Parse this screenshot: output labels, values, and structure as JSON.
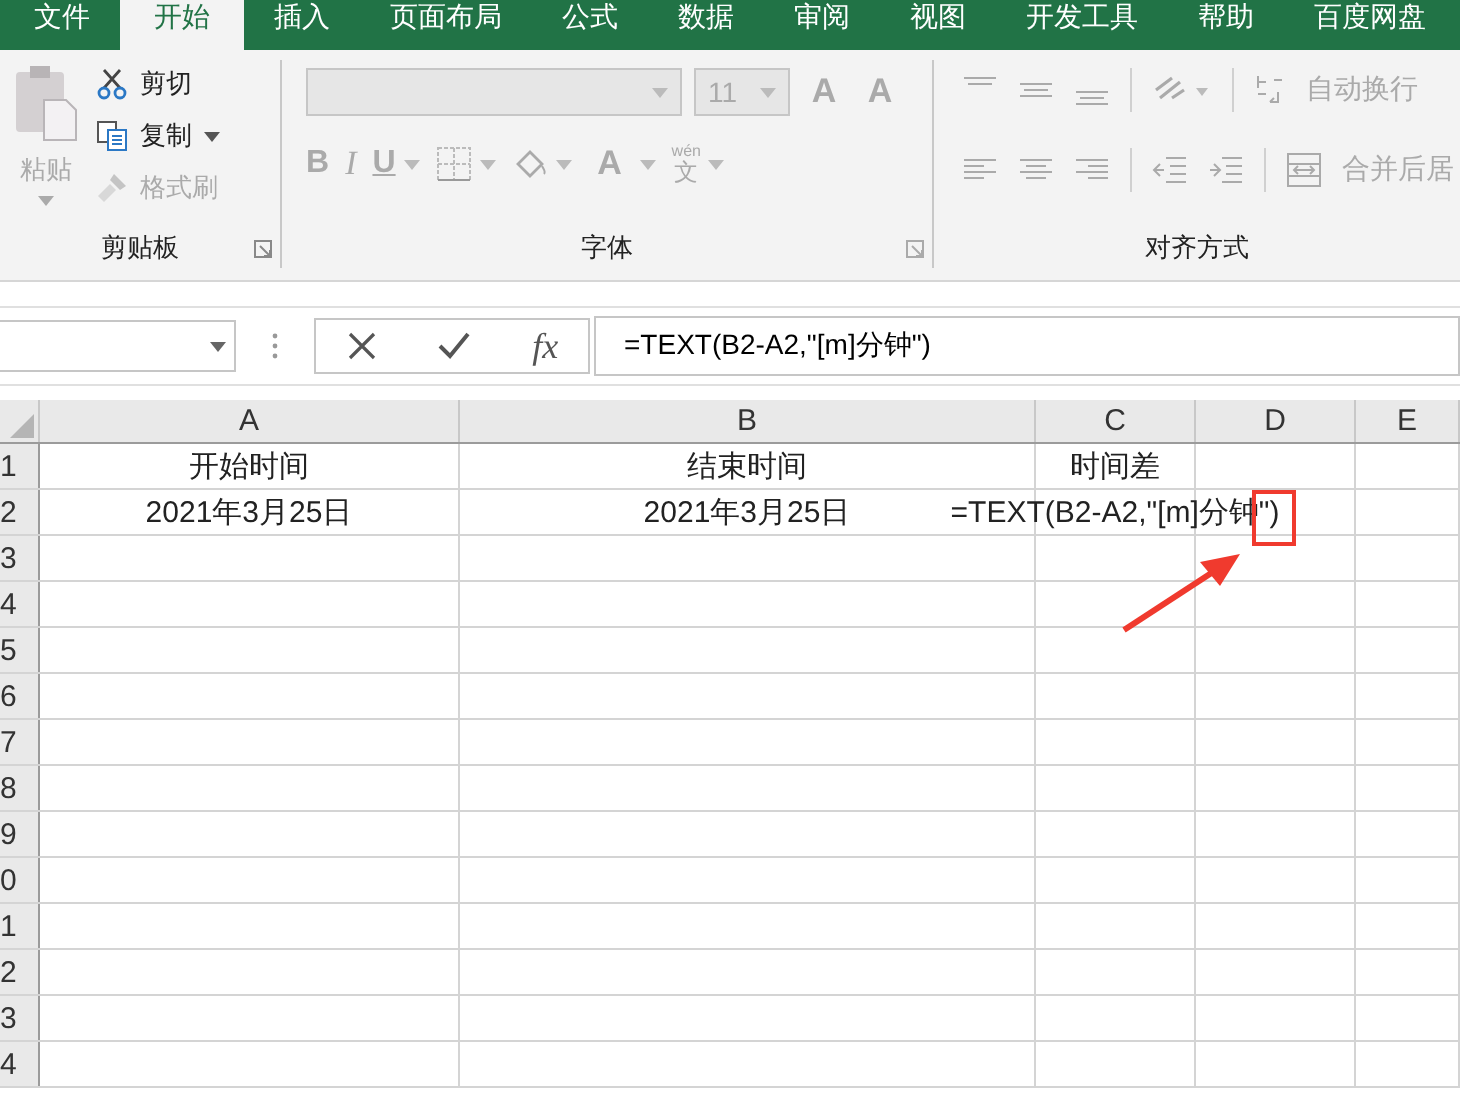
{
  "ribbon_tabs": [
    {
      "label": "文件",
      "selected": false
    },
    {
      "label": "开始",
      "selected": true
    },
    {
      "label": "插入",
      "selected": false
    },
    {
      "label": "页面布局",
      "selected": false
    },
    {
      "label": "公式",
      "selected": false
    },
    {
      "label": "数据",
      "selected": false
    },
    {
      "label": "审阅",
      "selected": false
    },
    {
      "label": "视图",
      "selected": false
    },
    {
      "label": "开发工具",
      "selected": false
    },
    {
      "label": "帮助",
      "selected": false
    },
    {
      "label": "百度网盘",
      "selected": false
    }
  ],
  "clipboard": {
    "paste": {
      "label": "粘贴",
      "disabled": true
    },
    "cut": {
      "label": "剪切",
      "disabled": false
    },
    "copy": {
      "label": "复制",
      "disabled": false
    },
    "format_painter": {
      "label": "格式刷",
      "disabled": true
    },
    "group_label": "剪贴板"
  },
  "font": {
    "size": "11",
    "bold": "B",
    "italic": "I",
    "underline": "U",
    "grow": "A",
    "shrink": "A",
    "font_color": "A",
    "phonetic_top": "wén",
    "phonetic_char": "文",
    "group_label": "字体"
  },
  "alignment": {
    "wrap_text": "自动换行",
    "merge": "合并后居",
    "group_label": "对齐方式"
  },
  "formula_bar": {
    "fx": "fx",
    "formula": "=TEXT(B2-A2,\"[m]分钟\")"
  },
  "columns": [
    "A",
    "B",
    "C",
    "D",
    "E"
  ],
  "rows": [
    {
      "number": "1",
      "cells": [
        "开始时间",
        "结束时间",
        "时间差"
      ]
    },
    {
      "number": "2",
      "cells": [
        "2021年3月25日",
        "2021年3月25日",
        "=TEXT(B2-A2,\"[m]分钟\")"
      ]
    },
    {
      "number": "3"
    },
    {
      "number": "4"
    },
    {
      "number": "5"
    },
    {
      "number": "6"
    },
    {
      "number": "7"
    },
    {
      "number": "8"
    },
    {
      "number": "9"
    },
    {
      "number": "0"
    },
    {
      "number": "1"
    },
    {
      "number": "2"
    },
    {
      "number": "3"
    },
    {
      "number": "4"
    }
  ]
}
